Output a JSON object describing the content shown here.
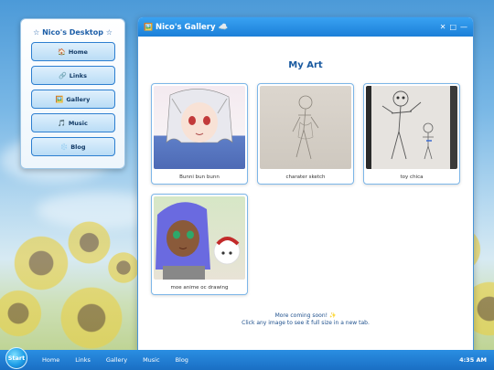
{
  "desktop": {
    "title": "Nico's Desktop",
    "title_prefix": "☆",
    "title_suffix": "☆",
    "nav": [
      {
        "icon": "🏠",
        "label": "Home"
      },
      {
        "icon": "🔗",
        "label": "Links"
      },
      {
        "icon": "🖼️",
        "label": "Gallery"
      },
      {
        "icon": "🎵",
        "label": "Music"
      },
      {
        "icon": "❄️",
        "label": "Blog"
      }
    ]
  },
  "window": {
    "icon": "🖼️",
    "title": "Nico's Gallery",
    "title_suffix": "☁️",
    "controls": {
      "close": "✕",
      "maximize": "□",
      "minimize": "—"
    },
    "heading": "My Art",
    "items": [
      {
        "caption": "Bunni bun bunn"
      },
      {
        "caption": "charater sketch"
      },
      {
        "caption": "toy chica"
      },
      {
        "caption": "moe anime oc drawing"
      }
    ],
    "footer_line1": "More coming soon! ✨",
    "footer_line2": "Click any image to see it full size in a new tab."
  },
  "taskbar": {
    "start_label": "Start",
    "links": [
      "Home",
      "Links",
      "Gallery",
      "Music",
      "Blog"
    ],
    "clock": "4:35 AM"
  },
  "colors": {
    "accent": "#1b7fd8",
    "nav_border": "#2d7fd0",
    "heading": "#1a5aa0"
  }
}
